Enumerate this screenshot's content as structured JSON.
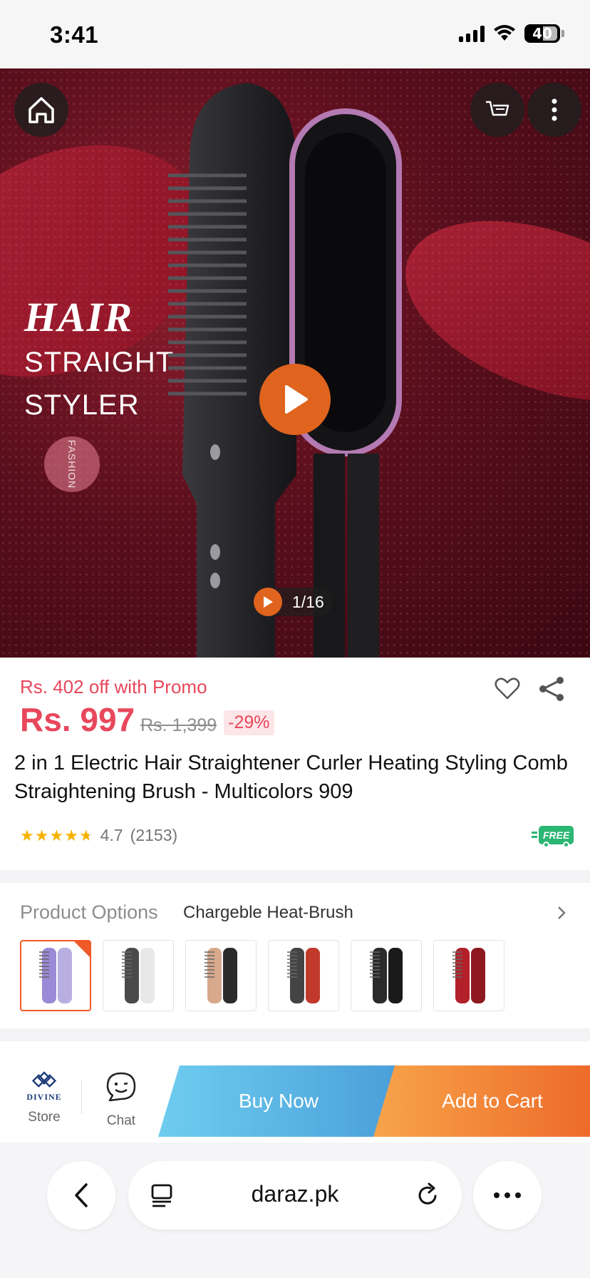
{
  "status_bar": {
    "time": "3:41",
    "battery": "40"
  },
  "hero": {
    "image_text": {
      "hair": "HAIR",
      "line1": "STRAIGHT",
      "line2": "STYLER",
      "badge": "FASHION"
    },
    "counter": "1/16"
  },
  "product": {
    "promo": "Rs. 402 off with Promo",
    "price": "Rs. 997",
    "old_price": "Rs. 1,399",
    "discount": "-29%",
    "title": "2 in 1 Electric Hair Straightener Curler Heating Styling Comb Straightening Brush - Multicolors 909",
    "rating": 4.7,
    "rating_text": "4.7",
    "rating_count": "(2153)",
    "free_badge": "FREE"
  },
  "options": {
    "label": "Product Options",
    "value": "Chargeble Heat-Brush",
    "variants": [
      {
        "name": "purple",
        "colors": [
          "#9b8ad6",
          "#b8aee0"
        ],
        "selected": true
      },
      {
        "name": "white",
        "colors": [
          "#4a4a4a",
          "#e8e8e8"
        ],
        "selected": false
      },
      {
        "name": "rose-gold",
        "colors": [
          "#d8a98c",
          "#2b2b2b"
        ],
        "selected": false
      },
      {
        "name": "multi",
        "colors": [
          "#444444",
          "#c0392b"
        ],
        "selected": false
      },
      {
        "name": "black",
        "colors": [
          "#2a2a2a",
          "#1a1a1a"
        ],
        "selected": false
      },
      {
        "name": "red",
        "colors": [
          "#b3202a",
          "#8e1820"
        ],
        "selected": false
      }
    ]
  },
  "actions": {
    "store_brand": "DIVINE",
    "store_label": "Store",
    "chat_label": "Chat",
    "buy_now": "Buy Now",
    "add_to_cart": "Add to Cart"
  },
  "browser": {
    "url": "daraz.pk"
  },
  "colors": {
    "accent": "#e8475c",
    "orange": "#e0641e",
    "free": "#2bb673"
  }
}
